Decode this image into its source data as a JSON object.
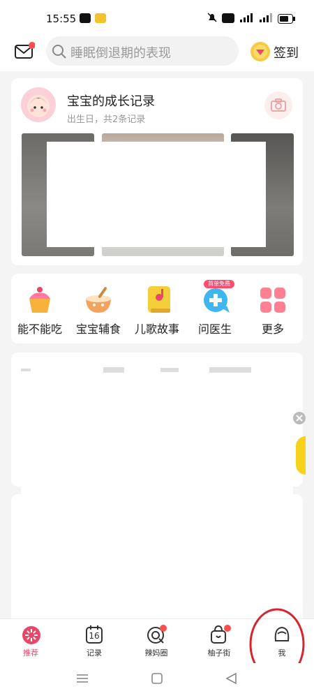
{
  "status_bar": {
    "time": "15:55"
  },
  "header": {
    "search_placeholder": "睡眠倒退期的表现",
    "signin_label": "签到"
  },
  "growth_card": {
    "title": "宝宝的成长记录",
    "subtitle": "出生日，共2条记录"
  },
  "tools": [
    {
      "label": "能不能吃",
      "icon": "cake-icon"
    },
    {
      "label": "宝宝辅食",
      "icon": "baby-food-bowl-icon"
    },
    {
      "label": "儿歌故事",
      "icon": "music-book-icon"
    },
    {
      "label": "问医生",
      "icon": "doctor-chat-icon",
      "badge": "首单免费"
    },
    {
      "label": "更多",
      "icon": "more-grid-icon"
    }
  ],
  "bottom_nav": [
    {
      "label": "推荐",
      "icon": "recommend-icon",
      "active": true
    },
    {
      "label": "记录",
      "icon": "calendar-icon",
      "date": "16"
    },
    {
      "label": "辣妈圈",
      "icon": "circle-icon"
    },
    {
      "label": "柚子街",
      "icon": "shop-bag-icon"
    },
    {
      "label": "我",
      "icon": "profile-icon"
    }
  ],
  "colors": {
    "accent": "#e8476a",
    "badge_red": "#ff4d4f"
  }
}
